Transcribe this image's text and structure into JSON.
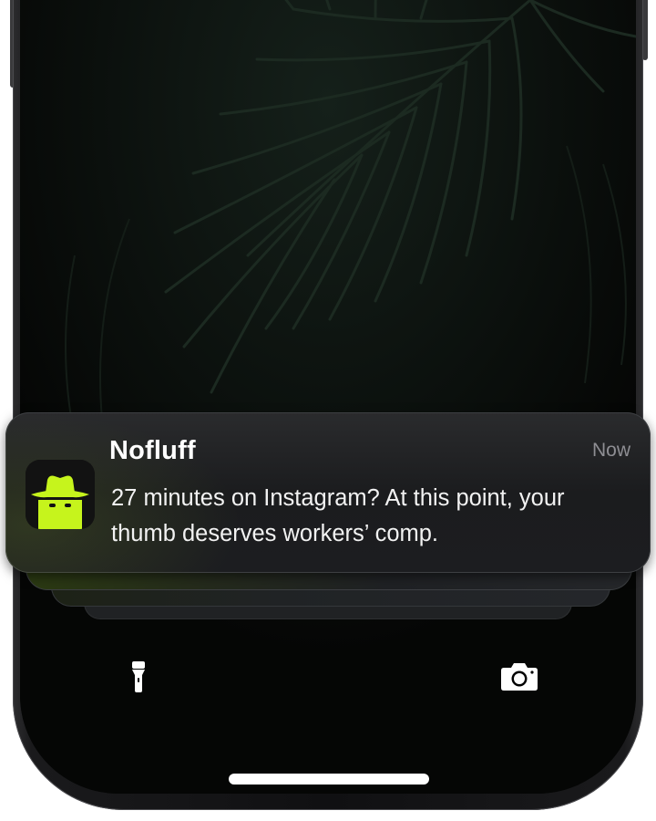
{
  "notification": {
    "app_name": "Nofluff",
    "timestamp": "Now",
    "message": "27 minutes on Instagram? At this point, your thumb deserves workers’ comp.",
    "app_icon": "nofluff-spy-hat-icon",
    "app_icon_color": "#c6f41c"
  },
  "lock_screen": {
    "left_control": "flashlight-icon",
    "right_control": "camera-icon",
    "accent_color": "#c6f41c"
  }
}
